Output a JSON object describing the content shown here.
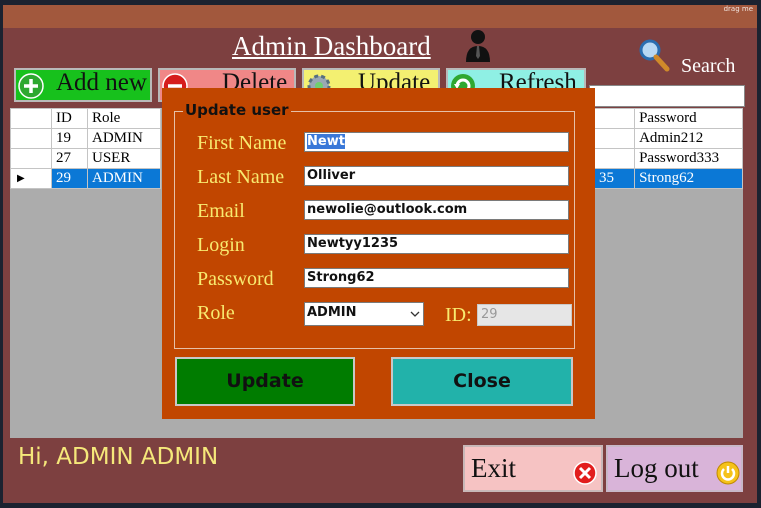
{
  "window": {
    "drag_label": "drag me",
    "title": "Admin Dashboard"
  },
  "search": {
    "label": "Search",
    "value": ""
  },
  "toolbar": {
    "add": "Add new",
    "delete": "Delete",
    "update": "Update",
    "refresh": "Refresh"
  },
  "grid": {
    "headers": {
      "left": [
        "ID",
        "Role"
      ],
      "right": "Password"
    },
    "rows": [
      {
        "id": "19",
        "role": "ADMIN",
        "right_partial": "",
        "password": "Admin212",
        "selected": false
      },
      {
        "id": "27",
        "role": "USER",
        "right_partial": "",
        "password": "Password333",
        "selected": false
      },
      {
        "id": "29",
        "role": "ADMIN",
        "right_partial": "35",
        "password": "Strong62",
        "selected": true
      }
    ]
  },
  "footer": {
    "greeting": "Hi, ADMIN ADMIN",
    "exit": "Exit",
    "logout": "Log out"
  },
  "dialog": {
    "group_title": "Update user",
    "labels": {
      "first": "First Name",
      "last": "Last Name",
      "email": "Email",
      "login": "Login",
      "password": "Password",
      "role": "Role",
      "id": "ID:"
    },
    "values": {
      "first": "Newt",
      "last": "Olliver",
      "email": "newolie@outlook.com",
      "login": "Newtyy1235",
      "password": "Strong62",
      "role": "ADMIN",
      "id": "29"
    },
    "update": "Update",
    "close": "Close"
  },
  "colors": {
    "window": "#7d4040",
    "dialog": "#c14600",
    "label": "#f8ea6f",
    "selection": "#0b78d6"
  }
}
